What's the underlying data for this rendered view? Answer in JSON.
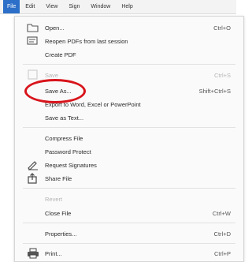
{
  "menubar": {
    "items": [
      "File",
      "Edit",
      "View",
      "Sign",
      "Window",
      "Help"
    ]
  },
  "menu": {
    "open": {
      "label": "Open...",
      "shortcut": "Ctrl+O"
    },
    "reopen": {
      "label": "Reopen PDFs from last session"
    },
    "create_pdf": {
      "label": "Create PDF"
    },
    "save": {
      "label": "Save",
      "shortcut": "Ctrl+S"
    },
    "save_as": {
      "label": "Save As...",
      "shortcut": "Shift+Ctrl+S"
    },
    "export": {
      "label": "Export to Word, Excel or PowerPoint"
    },
    "save_as_text": {
      "label": "Save as Text..."
    },
    "compress": {
      "label": "Compress File"
    },
    "password": {
      "label": "Password Protect"
    },
    "request_sig": {
      "label": "Request Signatures"
    },
    "share": {
      "label": "Share File"
    },
    "revert": {
      "label": "Revert"
    },
    "close": {
      "label": "Close File",
      "shortcut": "Ctrl+W"
    },
    "properties": {
      "label": "Properties...",
      "shortcut": "Ctrl+D"
    },
    "print": {
      "label": "Print...",
      "shortcut": "Ctrl+P"
    }
  },
  "colors": {
    "accent": "#2c6fc9",
    "highlight_circle": "#d8141b"
  },
  "icons": [
    "open-folder-icon",
    "reopen-icon",
    "request-signatures-icon",
    "share-icon",
    "print-icon"
  ]
}
